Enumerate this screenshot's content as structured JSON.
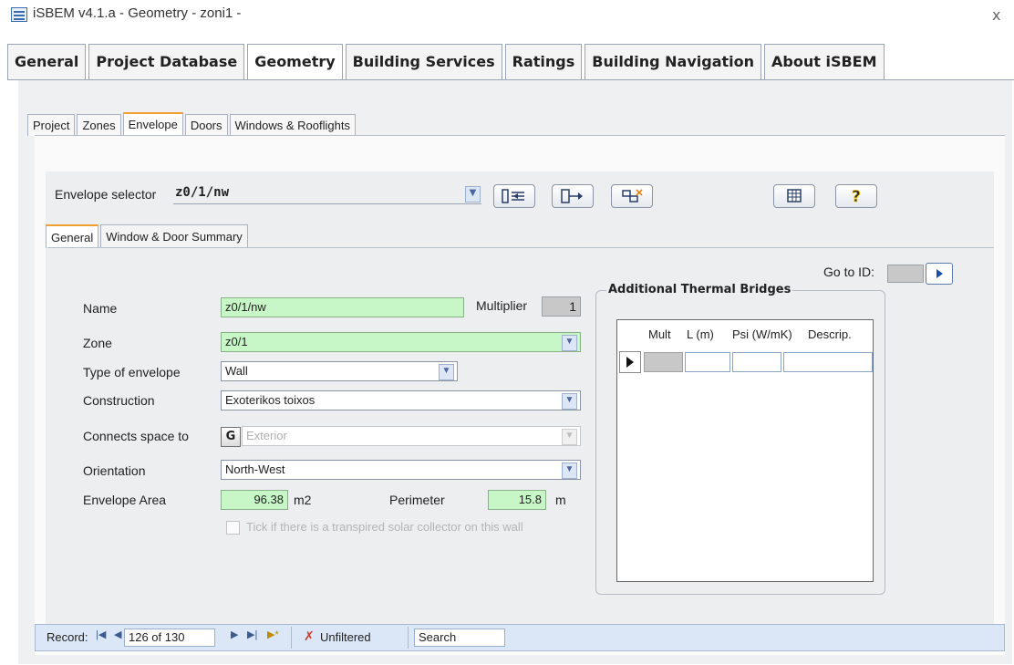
{
  "window": {
    "title": "iSBEM v4.1.a - Geometry - zoni1 -",
    "close_glyph": "x"
  },
  "main_tabs": [
    {
      "label": "General"
    },
    {
      "label": "Project Database"
    },
    {
      "label": "Geometry",
      "active": true
    },
    {
      "label": "Building Services"
    },
    {
      "label": "Ratings"
    },
    {
      "label": "Building Navigation"
    },
    {
      "label": "About iSBEM"
    }
  ],
  "sub_tabs": [
    {
      "label": "Project"
    },
    {
      "label": "Zones"
    },
    {
      "label": "Envelope",
      "active": true
    },
    {
      "label": "Doors"
    },
    {
      "label": "Windows & Rooflights"
    }
  ],
  "envelope_selector": {
    "label": "Envelope selector",
    "value": "z0/1/nw"
  },
  "toolbar_icons": [
    "add-record-icon",
    "copy-record-icon",
    "delete-record-icon",
    "table-view-icon",
    "help-icon"
  ],
  "form_tabs": [
    {
      "label": "General",
      "active": true
    },
    {
      "label": "Window & Door Summary"
    }
  ],
  "goto": {
    "label": "Go to ID:"
  },
  "form": {
    "name_label": "Name",
    "name_value": "z0/1/nw",
    "multiplier_label": "Multiplier",
    "multiplier_value": "1",
    "zone_label": "Zone",
    "zone_value": "z0/1",
    "type_label": "Type of envelope",
    "type_value": "Wall",
    "construction_label": "Construction",
    "construction_value": "Exoterikos toixos",
    "connects_label": "Connects space to",
    "connects_button": "G",
    "connects_value": "Exterior",
    "orientation_label": "Orientation",
    "orientation_value": "North-West",
    "area_label": "Envelope Area",
    "area_value": "96.38",
    "area_unit": "m2",
    "perimeter_label": "Perimeter",
    "perimeter_value": "15.8",
    "perimeter_unit": "m",
    "solar_checkbox_label": "Tick if there is a transpired solar collector on this wall"
  },
  "thermal_bridges": {
    "title": "Additional Thermal Bridges",
    "columns": [
      "Mult",
      "L (m)",
      "Psi (W/mK)",
      "Descrip."
    ]
  },
  "record_nav": {
    "label": "Record:",
    "position": "126 of 130",
    "filter": "Unfiltered",
    "search": "Search"
  },
  "colors": {
    "field_green": "#c7f7c7",
    "tab_accent": "#f0a030",
    "nav_bar": "#dbe7f6"
  }
}
